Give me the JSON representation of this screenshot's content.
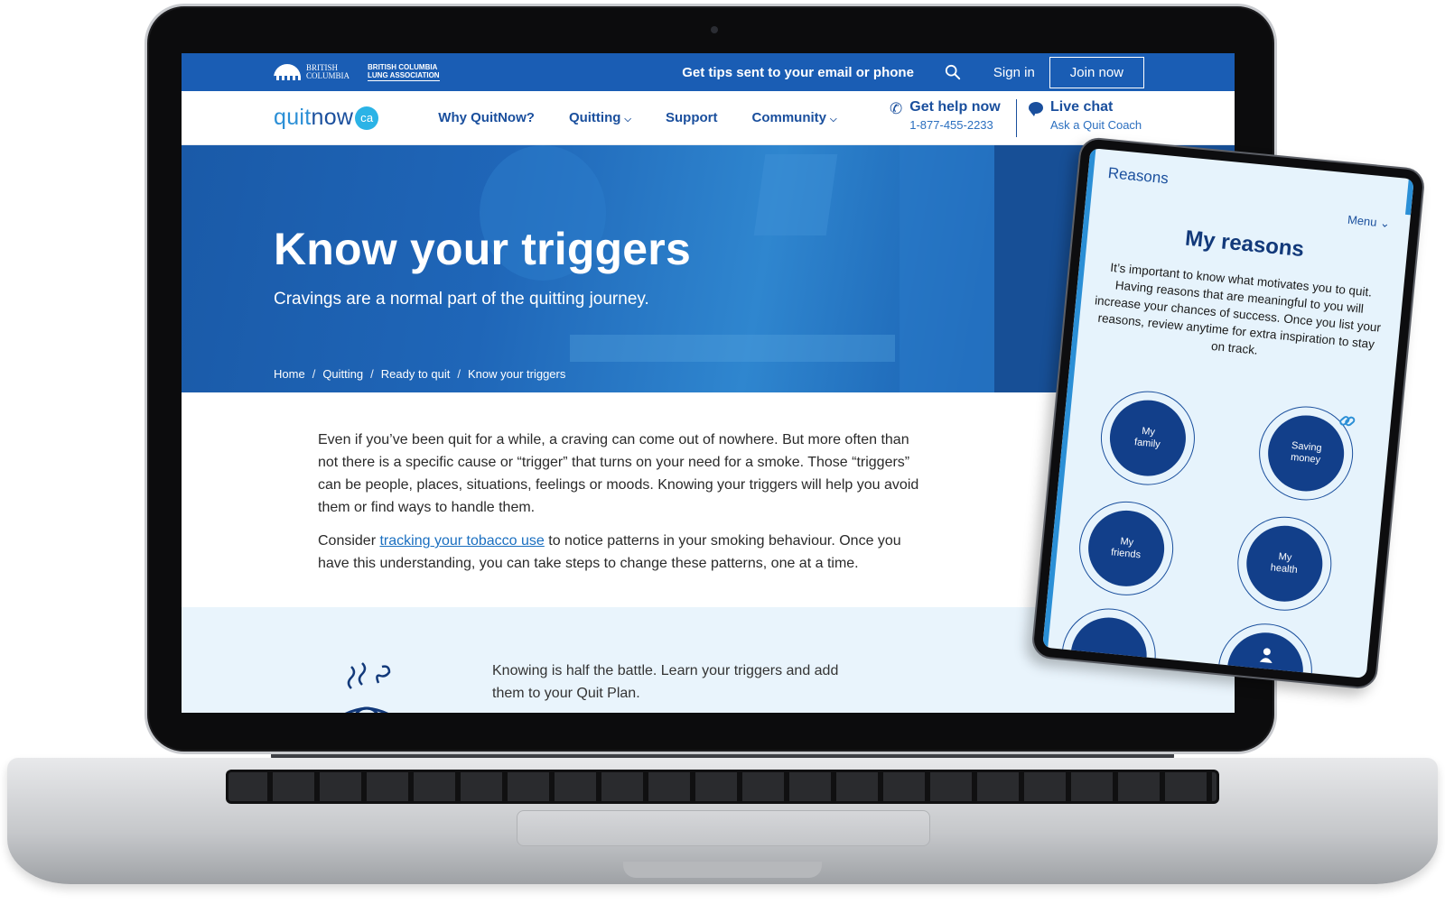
{
  "topbar": {
    "gov_logo_line1": "BRITISH",
    "gov_logo_line2": "COLUMBIA",
    "lung_logo_line1": "BRITISH COLUMBIA",
    "lung_logo_line2": "LUNG ASSOCIATION",
    "tips_link": "Get tips sent to your email or phone",
    "signin": "Sign in",
    "join": "Join now"
  },
  "nav": {
    "brand_quit": "quit",
    "brand_now": "now",
    "brand_ca": "ca",
    "items": [
      {
        "label": "Why QuitNow?"
      },
      {
        "label": "Quitting",
        "dropdown": true
      },
      {
        "label": "Support"
      },
      {
        "label": "Community",
        "dropdown": true
      }
    ],
    "help_title": "Get help now",
    "help_phone": "1-877-455-2233",
    "chat_title": "Live chat",
    "chat_sub": "Ask a Quit Coach"
  },
  "hero": {
    "title": "Know your triggers",
    "subtitle": "Cravings are a normal part of the quitting journey.",
    "breadcrumb": [
      "Home",
      "Quitting",
      "Ready to quit",
      "Know your triggers"
    ]
  },
  "body": {
    "p1": "Even if you’ve been quit for a while, a craving can come out of nowhere. But more often than not there is a specific cause or “trigger” that turns on your need for a smoke. Those “triggers” can be people, places, situations, feelings or moods. Knowing your triggers will help you avoid them or find ways to handle them.",
    "p2_before": "Consider ",
    "p2_link": "tracking your tobacco use",
    "p2_after": " to notice patterns in your smoking behaviour. Once you have this understanding, you can take steps to change these patterns, one at a time.",
    "band_text": "Knowing is half the battle. Learn your triggers and add them to your Quit Plan."
  },
  "phone": {
    "header": "Reasons",
    "menu": "Menu",
    "title": "My reasons",
    "text": "It’s important to know what motivates you to quit. Having reasons that are  meaningful to you will increase your chances of success. Once you list your reasons, review anytime for extra inspiration to stay on track.",
    "reasons": [
      {
        "line1": "My",
        "line2": "family"
      },
      {
        "line1": "Saving",
        "line2": "money"
      },
      {
        "line1": "My",
        "line2": "friends"
      },
      {
        "line1": "My",
        "line2": "health"
      }
    ]
  },
  "colors": {
    "brand_blue": "#1a5db4",
    "navy": "#1a4f9d",
    "light_band": "#e9f4fc"
  },
  "icons": [
    "search-icon",
    "phone-icon",
    "chat-bubble-icon",
    "chevron-down-icon",
    "link-icon",
    "person-icon"
  ]
}
